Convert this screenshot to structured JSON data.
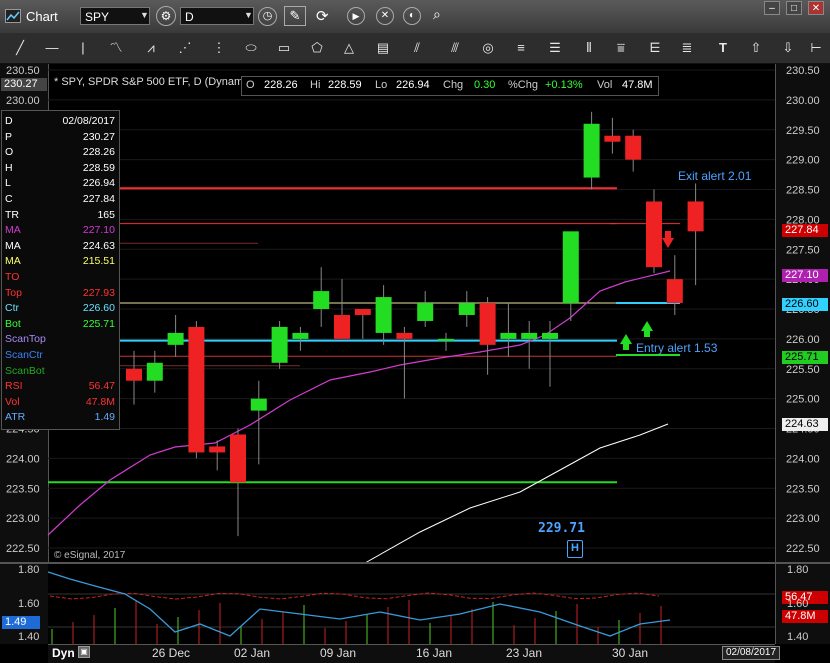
{
  "window": {
    "title": "Chart",
    "symbol": "SPY",
    "interval": "D",
    "min_btn": "–",
    "max_btn": "□",
    "close_btn": "✕"
  },
  "chart": {
    "header": "* SPY, SPDR S&P 500 ETF, D (Dynamic)",
    "watermark": "© eSignal, 2017",
    "ohlc": {
      "o_label": "O",
      "o": "228.26",
      "h_label": "Hi",
      "h": "228.59",
      "l_label": "Lo",
      "l": "226.94",
      "chg_label": "Chg",
      "chg": "0.30",
      "pchg_label": "%Chg",
      "pchg": "+0.13%",
      "vol_label": "Vol",
      "vol": "47.8M"
    },
    "alerts": {
      "exit": "Exit alert 2.01",
      "entry": "Entry alert 1.53",
      "h_value": "229.71",
      "h_marker": "H"
    },
    "info_panel": [
      {
        "label": "D",
        "value": "02/08/2017",
        "color": "#ffffff"
      },
      {
        "label": "P",
        "value": "230.27",
        "color": "#ffffff"
      },
      {
        "label": "O",
        "value": "228.26",
        "color": "#ffffff"
      },
      {
        "label": "H",
        "value": "228.59",
        "color": "#ffffff"
      },
      {
        "label": "L",
        "value": "226.94",
        "color": "#ffffff"
      },
      {
        "label": "C",
        "value": "227.84",
        "color": "#ffffff"
      },
      {
        "label": "TR",
        "value": "165",
        "color": "#ffffff"
      },
      {
        "label": "MA",
        "value": "227.10",
        "color": "#d23cd2"
      },
      {
        "label": "MA",
        "value": "224.63",
        "color": "#ffffff"
      },
      {
        "label": "MA",
        "value": "215.51",
        "color": "#ffff66"
      },
      {
        "label": "TO",
        "value": "",
        "color": "#ff3333"
      },
      {
        "label": "Top",
        "value": "227.93",
        "color": "#ff3333"
      },
      {
        "label": "Ctr",
        "value": "226.60",
        "color": "#66e0ff"
      },
      {
        "label": "Bot",
        "value": "225.71",
        "color": "#33ff33"
      },
      {
        "label": "ScanTop",
        "value": "",
        "color": "#a78bfa"
      },
      {
        "label": "ScanCtr",
        "value": "",
        "color": "#3b82f6"
      },
      {
        "label": "ScanBot",
        "value": "",
        "color": "#22aa22"
      },
      {
        "label": "RSI",
        "value": "56.47",
        "color": "#ff3333"
      },
      {
        "label": "Vol",
        "value": "47.8M",
        "color": "#ff3333"
      },
      {
        "label": "ATR",
        "value": "1.49",
        "color": "#66aaff"
      }
    ],
    "price_tags": {
      "left_last": "230.27",
      "close": "227.84",
      "ma_fast": "227.10",
      "ctr": "226.60",
      "bot": "225.71",
      "ma_slow": "224.63",
      "rsi": "56.47",
      "vol": "47.8M",
      "atr": "1.49"
    },
    "sub_panel_ticks": [
      "1.80",
      "1.60",
      "1.40"
    ],
    "xaxis": {
      "label": "Dyn",
      "ticks": [
        "26 Dec",
        "02 Jan",
        "09 Jan",
        "16 Jan",
        "23 Jan",
        "30 Jan"
      ],
      "date_box": "02/08/2017"
    }
  },
  "chart_data": {
    "type": "candlestick",
    "ylim": [
      222.4,
      230.5
    ],
    "yticks": [
      222.5,
      223.0,
      223.5,
      224.0,
      224.5,
      225.0,
      225.5,
      226.0,
      226.5,
      227.0,
      227.5,
      228.0,
      228.5,
      229.0,
      229.5,
      230.0,
      230.5
    ],
    "candles": [
      {
        "o": 225.5,
        "h": 225.8,
        "l": 224.9,
        "c": 225.3
      },
      {
        "o": 225.3,
        "h": 225.8,
        "l": 225.1,
        "c": 225.6
      },
      {
        "o": 225.9,
        "h": 226.4,
        "l": 225.7,
        "c": 226.1
      },
      {
        "o": 226.2,
        "h": 226.3,
        "l": 224.0,
        "c": 224.1
      },
      {
        "o": 224.2,
        "h": 224.3,
        "l": 223.8,
        "c": 224.1
      },
      {
        "o": 224.4,
        "h": 224.5,
        "l": 222.7,
        "c": 223.6
      },
      {
        "o": 224.8,
        "h": 225.3,
        "l": 223.9,
        "c": 225.0
      },
      {
        "o": 225.6,
        "h": 226.3,
        "l": 225.5,
        "c": 226.2
      },
      {
        "o": 226.0,
        "h": 226.2,
        "l": 225.8,
        "c": 226.1
      },
      {
        "o": 226.5,
        "h": 227.2,
        "l": 226.2,
        "c": 226.8
      },
      {
        "o": 226.4,
        "h": 227.0,
        "l": 226.1,
        "c": 226.0
      },
      {
        "o": 226.5,
        "h": 226.5,
        "l": 226.0,
        "c": 226.4
      },
      {
        "o": 226.1,
        "h": 226.9,
        "l": 225.9,
        "c": 226.7
      },
      {
        "o": 226.1,
        "h": 226.2,
        "l": 225.0,
        "c": 226.0
      },
      {
        "o": 226.3,
        "h": 226.8,
        "l": 226.2,
        "c": 226.6
      },
      {
        "o": 226.0,
        "h": 226.1,
        "l": 225.8,
        "c": 226.0
      },
      {
        "o": 226.4,
        "h": 226.8,
        "l": 226.2,
        "c": 226.6
      },
      {
        "o": 226.6,
        "h": 226.7,
        "l": 225.4,
        "c": 225.9
      },
      {
        "o": 226.0,
        "h": 226.6,
        "l": 225.7,
        "c": 226.1
      },
      {
        "o": 226.0,
        "h": 226.3,
        "l": 225.5,
        "c": 226.1
      },
      {
        "o": 226.0,
        "h": 226.3,
        "l": 225.2,
        "c": 226.1
      },
      {
        "o": 226.6,
        "h": 227.3,
        "l": 226.3,
        "c": 227.8
      },
      {
        "o": 228.7,
        "h": 229.8,
        "l": 228.5,
        "c": 229.6
      },
      {
        "o": 229.4,
        "h": 229.7,
        "l": 229.1,
        "c": 229.3
      },
      {
        "o": 229.4,
        "h": 229.5,
        "l": 228.8,
        "c": 229.0
      },
      {
        "o": 228.3,
        "h": 228.5,
        "l": 227.1,
        "c": 227.2
      },
      {
        "o": 227.0,
        "h": 227.4,
        "l": 226.4,
        "c": 226.6
      },
      {
        "o": 228.3,
        "h": 228.6,
        "l": 226.9,
        "c": 227.8
      }
    ],
    "levels": {
      "red_top": 228.52,
      "top": 227.93,
      "ctr": 226.6,
      "cyan": 225.97,
      "bot": 225.71,
      "green_low": 223.6
    }
  }
}
